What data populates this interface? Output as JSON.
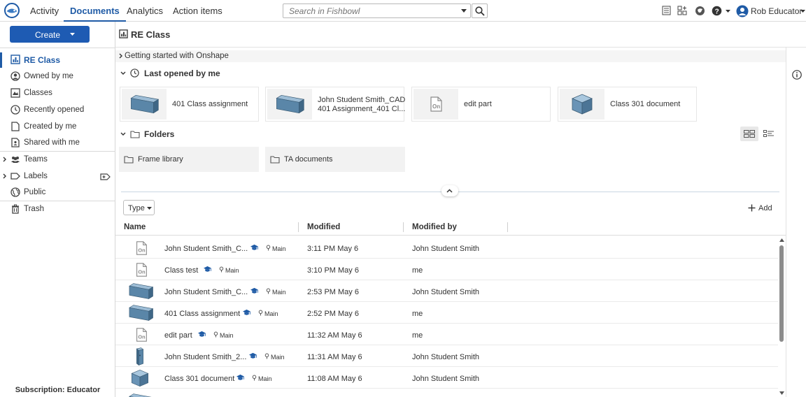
{
  "nav": {
    "tabs": [
      {
        "label": "Activity",
        "active": false
      },
      {
        "label": "Documents",
        "active": true
      },
      {
        "label": "Analytics",
        "active": false
      },
      {
        "label": "Action items",
        "active": false
      }
    ],
    "search_placeholder": "Search in Fishbowl",
    "user_name": "Rob Educator"
  },
  "sidebar": {
    "create_label": "Create",
    "items": [
      {
        "label": "RE Class",
        "icon": "class-icon",
        "active": true
      },
      {
        "label": "Owned by me",
        "icon": "user-circle-icon"
      },
      {
        "label": "Classes",
        "icon": "classes-icon"
      },
      {
        "label": "Recently opened",
        "icon": "clock-icon"
      },
      {
        "label": "Created by me",
        "icon": "document-icon"
      },
      {
        "label": "Shared with me",
        "icon": "shared-icon"
      },
      {
        "label": "Teams",
        "icon": "team-icon"
      },
      {
        "label": "Labels",
        "icon": "label-icon"
      },
      {
        "label": "Public",
        "icon": "globe-icon"
      },
      {
        "label": "Trash",
        "icon": "trash-icon"
      }
    ],
    "subscription": "Subscription: Educator"
  },
  "page": {
    "title": "RE Class"
  },
  "main": {
    "getting_started": "Getting started with Onshape",
    "last_opened_title": "Last opened by me",
    "recent_cards": [
      {
        "name_line1": "401 Class assignment",
        "name_line2": "",
        "thumb": "slab"
      },
      {
        "name_line1": "John Student Smith_CAD",
        "name_line2": "401 Assignment_401 Cl...",
        "thumb": "slab"
      },
      {
        "name_line1": "edit part",
        "name_line2": "",
        "thumb": "onshape-doc"
      },
      {
        "name_line1": "Class 301 document",
        "name_line2": "",
        "thumb": "cube"
      }
    ],
    "folders_title": "Folders",
    "folders": [
      "Frame library",
      "TA documents"
    ],
    "type_filter": "Type",
    "add_label": "Add",
    "columns": {
      "name": "Name",
      "modified": "Modified",
      "modified_by": "Modified by"
    },
    "rows": [
      {
        "name": "John Student Smith_C...",
        "branch": "Main",
        "modified": "3:11 PM May 6",
        "modified_by": "John Student Smith",
        "thumb": "onshape-doc"
      },
      {
        "name": "Class test",
        "branch": "Main",
        "modified": "3:10 PM May 6",
        "modified_by": "me",
        "thumb": "onshape-doc"
      },
      {
        "name": "John Student Smith_C...",
        "branch": "Main",
        "modified": "2:53 PM May 6",
        "modified_by": "John Student Smith",
        "thumb": "slab"
      },
      {
        "name": "401 Class assignment",
        "branch": "Main",
        "modified": "2:52 PM May 6",
        "modified_by": "me",
        "thumb": "slab"
      },
      {
        "name": "edit part",
        "branch": "Main",
        "modified": "11:32 AM May 6",
        "modified_by": "me",
        "thumb": "onshape-doc"
      },
      {
        "name": "John Student Smith_2...",
        "branch": "Main",
        "modified": "11:31 AM May 6",
        "modified_by": "John Student Smith",
        "thumb": "tall-block"
      },
      {
        "name": "Class 301 document",
        "branch": "Main",
        "modified": "11:08 AM May 6",
        "modified_by": "John Student Smith",
        "thumb": "cube"
      }
    ]
  },
  "colors": {
    "accent": "#1f5ba6",
    "create_button": "#1e5bb3",
    "model_blue": "#5a86a8"
  }
}
